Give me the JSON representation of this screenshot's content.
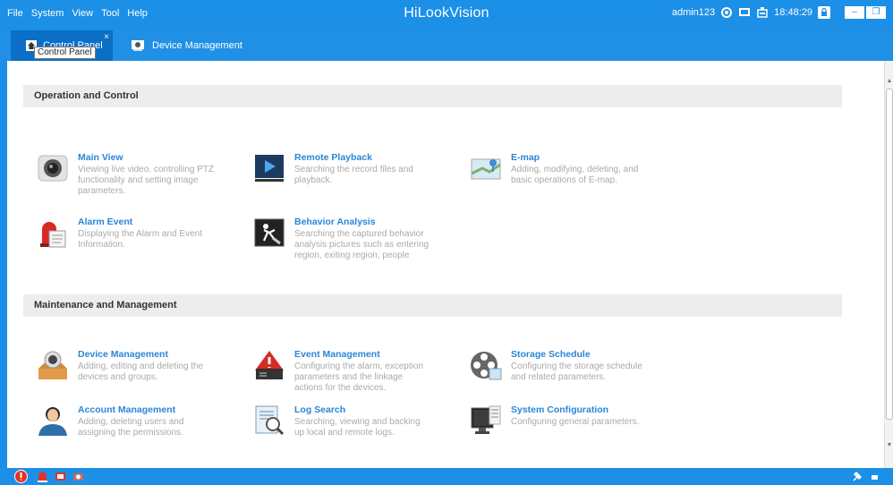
{
  "menu": {
    "file": "File",
    "system": "System",
    "view": "View",
    "tool": "Tool",
    "help": "Help"
  },
  "brand": "HiLookVision",
  "status": {
    "user": "admin123",
    "time": "18:48:29"
  },
  "window": {
    "minimize": "–",
    "restore": "❐"
  },
  "tabs": [
    {
      "label": "Control Panel",
      "close": "×"
    },
    {
      "label": "Device Management"
    }
  ],
  "tooltip": "Control Panel",
  "sections": [
    {
      "title": "Operation and Control",
      "items": [
        {
          "title": "Main View",
          "desc": "Viewing live video, controlling PTZ functionality and setting image parameters.",
          "icon": "camera-icon"
        },
        {
          "title": "Remote Playback",
          "desc": "Searching the record files and playback.",
          "icon": "play-icon"
        },
        {
          "title": "E-map",
          "desc": "Adding, modifying, deleting, and basic operations of E-map.",
          "icon": "map-icon"
        },
        {
          "title": "Alarm Event",
          "desc": "Displaying the Alarm and Event Information.",
          "icon": "alarm-siren-icon"
        },
        {
          "title": "Behavior Analysis",
          "desc": "Searching the captured behavior analysis pictures such as entering region, exiting region, people",
          "icon": "behavior-icon"
        }
      ]
    },
    {
      "title": "Maintenance and Management",
      "items": [
        {
          "title": "Device Management",
          "desc": "Adding, editing and deleting the devices and groups.",
          "icon": "device-icon"
        },
        {
          "title": "Event Management",
          "desc": "Configuring the alarm, exception parameters and the linkage actions for the devices.",
          "icon": "event-icon"
        },
        {
          "title": "Storage Schedule",
          "desc": "Configuring the storage schedule and related parameters.",
          "icon": "film-reel-icon"
        },
        {
          "title": "Account Management",
          "desc": "Adding, deleting users and assigning the permissions.",
          "icon": "user-icon"
        },
        {
          "title": "Log Search",
          "desc": "Searching, viewing and backing up local and remote logs.",
          "icon": "log-search-icon"
        },
        {
          "title": "System Configuration",
          "desc": "Configuring general parameters.",
          "icon": "system-config-icon"
        }
      ]
    }
  ],
  "colors": {
    "accent": "#1c8fe6",
    "tabActive": "#0b6fc6",
    "link": "#2a86d6",
    "desc": "#aaaaaa"
  }
}
